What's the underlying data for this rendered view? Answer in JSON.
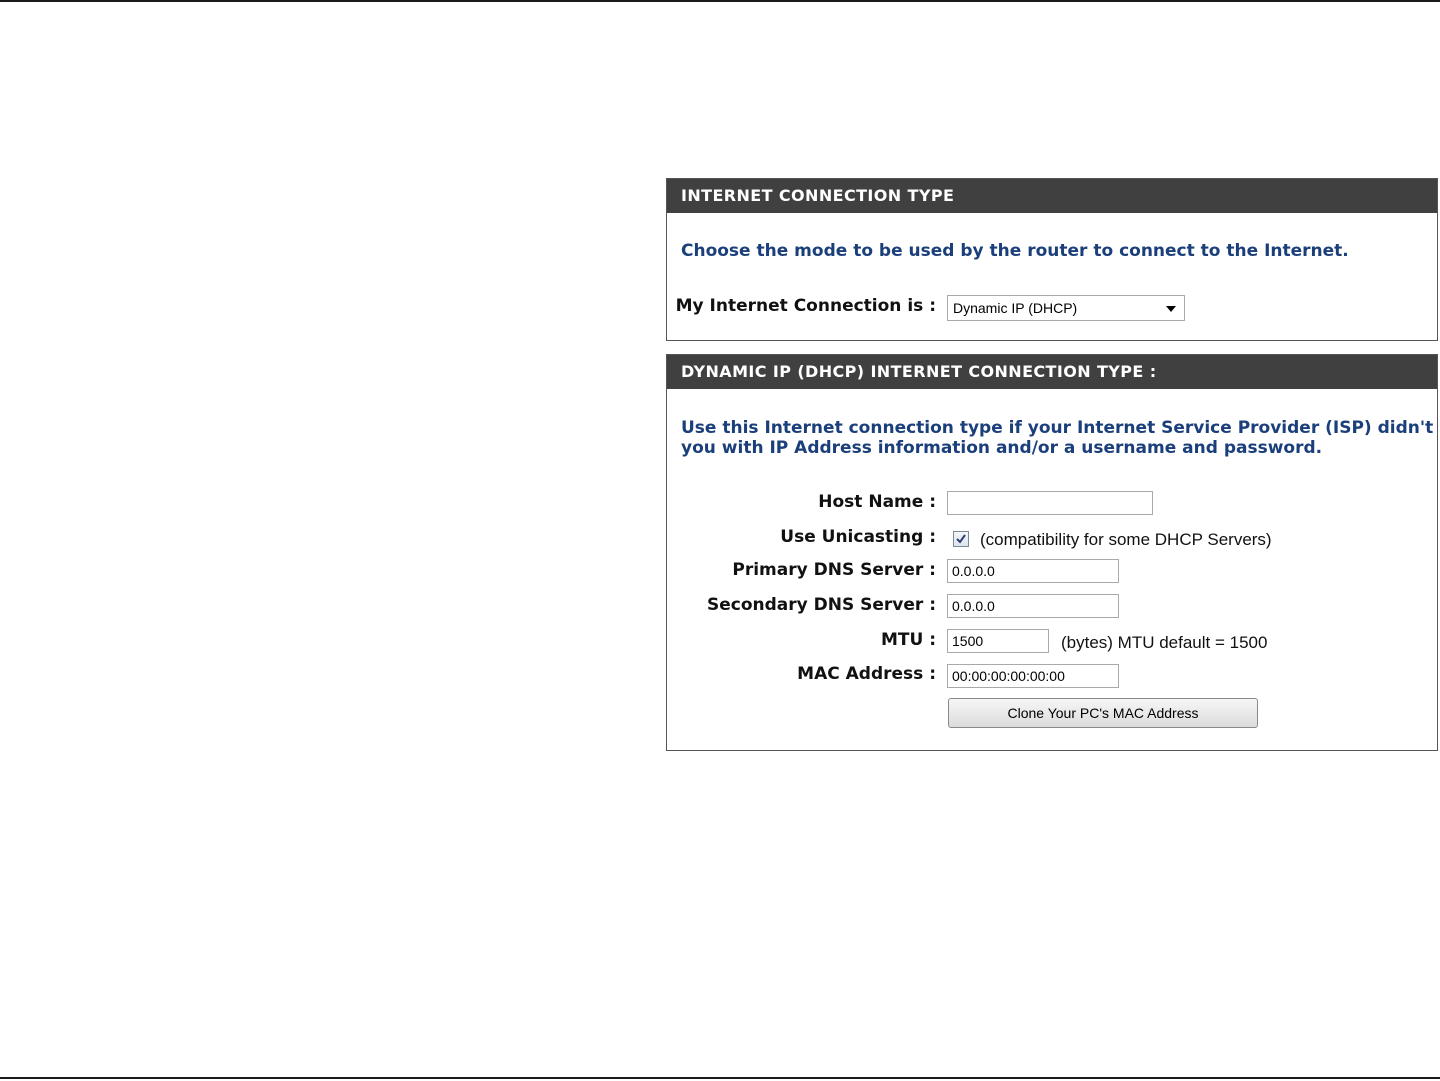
{
  "connection_type": {
    "header": "INTERNET CONNECTION TYPE",
    "description": "Choose the mode to be used by the router to connect to the Internet.",
    "label": "My Internet Connection is :",
    "selected": "Dynamic IP (DHCP)"
  },
  "dhcp": {
    "header": "DYNAMIC IP (DHCP) INTERNET CONNECTION TYPE :",
    "description_line1": "Use this Internet connection type if your Internet Service Provider (ISP) didn't provide",
    "description_line2": "you with IP Address information and/or a username and password.",
    "host_name": {
      "label": "Host Name :",
      "value": ""
    },
    "unicasting": {
      "label": "Use Unicasting :",
      "checked": true,
      "note": "(compatibility for some DHCP Servers)"
    },
    "primary_dns": {
      "label": "Primary DNS Server :",
      "value": "0.0.0.0"
    },
    "secondary_dns": {
      "label": "Secondary DNS Server :",
      "value": "0.0.0.0"
    },
    "mtu": {
      "label": "MTU :",
      "value": "1500",
      "note": "(bytes) MTU default = 1500"
    },
    "mac": {
      "label": "MAC Address :",
      "value": "00:00:00:00:00:00"
    },
    "clone_button": "Clone Your PC's MAC Address"
  }
}
